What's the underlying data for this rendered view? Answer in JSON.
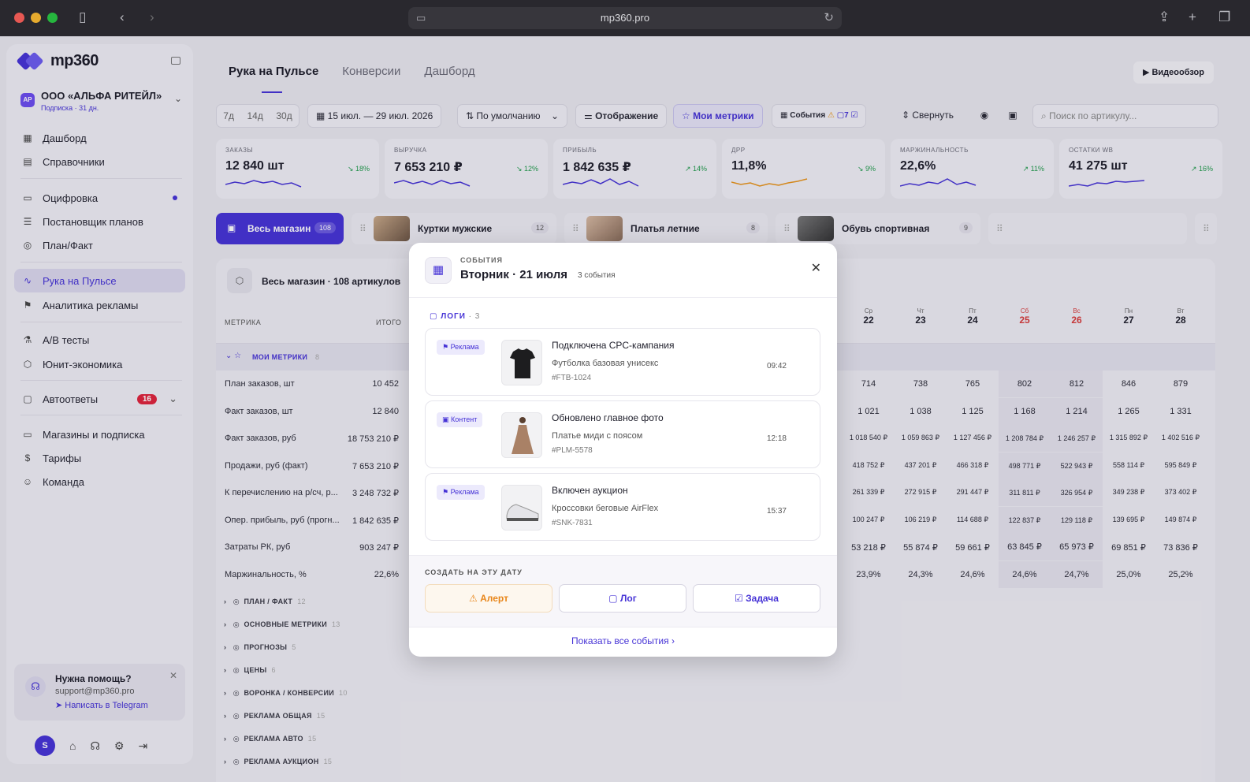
{
  "browser": {
    "url": "mp360.pro"
  },
  "sidebar": {
    "logo": "mp360",
    "org": {
      "avatar": "AP",
      "name": "ООО «АЛЬФА РИТЕЙЛ»",
      "sub": "Подписка · 31 дн."
    },
    "items": [
      {
        "label": "Дашборд",
        "icon": "▦"
      },
      {
        "label": "Справочники",
        "icon": "▤"
      },
      {
        "label": "Оцифровка",
        "icon": "▭"
      },
      {
        "label": "Постановщик планов",
        "icon": "☰"
      },
      {
        "label": "План/Факт",
        "icon": "◎"
      },
      {
        "label": "Рука на Пульсе",
        "icon": "∿"
      },
      {
        "label": "Аналитика рекламы",
        "icon": "⚑"
      },
      {
        "label": "A/B тесты",
        "icon": "⚗"
      },
      {
        "label": "Юнит-экономика",
        "icon": "⬡"
      },
      {
        "label": "Автоответы",
        "icon": "▢",
        "badge": "16"
      },
      {
        "label": "Магазины и подписка",
        "icon": "▭"
      },
      {
        "label": "Тарифы",
        "icon": "$"
      },
      {
        "label": "Команда",
        "icon": "☺"
      }
    ],
    "help": {
      "title": "Нужна помощь?",
      "email": "support@mp360.pro",
      "link": "Написать в Telegram"
    },
    "user": "S"
  },
  "main": {
    "tabs": [
      "Рука на Пульсе",
      "Конверсии",
      "Дашборд"
    ],
    "video": "Видеообзор",
    "toolbar": {
      "d7": "7д",
      "d14": "14д",
      "d30": "30д",
      "range": "15 июл. — 29 июл. 2026",
      "sort": "По умолчанию",
      "display": "Отображение",
      "my": "Мои метрики",
      "events": "События",
      "evcount": "7",
      "collapse": "Свернуть",
      "search_placeholder": "Поиск по артикулу..."
    },
    "kpis": [
      {
        "label": "ЗАКАЗЫ",
        "value": "12 840 шт",
        "change": "↘ 18%",
        "color": "#4633d6"
      },
      {
        "label": "ВЫРУЧКА",
        "value": "7 653 210 ₽",
        "change": "↘ 12%",
        "color": "#4633d6"
      },
      {
        "label": "ПРИБЫЛЬ",
        "value": "1 842 635 ₽",
        "change": "↗ 14%",
        "color": "#4633d6"
      },
      {
        "label": "ДРР",
        "value": "11,8%",
        "change": "↘ 9%",
        "color": "#e8941a"
      },
      {
        "label": "МАРЖИНАЛЬНОСТЬ",
        "value": "22,6%",
        "change": "↗ 11%",
        "color": "#4633d6"
      },
      {
        "label": "ОСТАТКИ WB",
        "value": "41 275 шт",
        "change": "↗ 16%",
        "color": "#4633d6"
      }
    ],
    "segments": [
      {
        "name": "Весь магазин",
        "count": "108"
      },
      {
        "name": "Куртки мужские",
        "count": "12"
      },
      {
        "name": "Платья летние",
        "count": "8"
      },
      {
        "name": "Обувь спортивная",
        "count": "9"
      }
    ],
    "table": {
      "title": "Весь магазин · 108 артикулов",
      "col_metric": "МЕТРИКА",
      "col_total": "ИТОГО",
      "days": [
        {
          "w": "Ср",
          "d": "22"
        },
        {
          "w": "Чт",
          "d": "23"
        },
        {
          "w": "Пт",
          "d": "24"
        },
        {
          "w": "Сб",
          "d": "25"
        },
        {
          "w": "Вс",
          "d": "26"
        },
        {
          "w": "Пн",
          "d": "27"
        },
        {
          "w": "Вт",
          "d": "28"
        }
      ],
      "my_metrics": "МОИ МЕТРИКИ",
      "my_count": "8",
      "rows": [
        {
          "m": "План заказов, шт",
          "t": "10 452",
          "v": [
            "714",
            "738",
            "765",
            "802",
            "812",
            "846",
            "879"
          ]
        },
        {
          "m": "Факт заказов, шт",
          "t": "12 840",
          "v": [
            "1 021",
            "1 038",
            "1 125",
            "1 168",
            "1 214",
            "1 265",
            "1 331"
          ]
        },
        {
          "m": "Факт заказов, руб",
          "t": "18 753 210 ₽",
          "v": [
            "1 018 540 ₽",
            "1 059 863 ₽",
            "1 127 456 ₽",
            "1 208 784 ₽",
            "1 246 257 ₽",
            "1 315 892 ₽",
            "1 402 516 ₽"
          ]
        },
        {
          "m": "Продажи, руб (факт)",
          "t": "7 653 210 ₽",
          "v": [
            "418 752 ₽",
            "437 201 ₽",
            "466 318 ₽",
            "498 771 ₽",
            "522 943 ₽",
            "558 114 ₽",
            "595 849 ₽"
          ]
        },
        {
          "m": "К перечислению на р/сч, р...",
          "t": "3 248 732 ₽",
          "v": [
            "261 339 ₽",
            "272 915 ₽",
            "291 447 ₽",
            "311 811 ₽",
            "326 954 ₽",
            "349 238 ₽",
            "373 402 ₽"
          ]
        },
        {
          "m": "Опер. прибыль, руб (прогн...",
          "t": "1 842 635 ₽",
          "v": [
            "100 247 ₽",
            "106 219 ₽",
            "114 688 ₽",
            "122 837 ₽",
            "129 118 ₽",
            "139 695 ₽",
            "149 874 ₽"
          ]
        },
        {
          "m": "Затраты РК, руб",
          "t": "903 247 ₽",
          "v": [
            "53 218 ₽",
            "55 874 ₽",
            "59 661 ₽",
            "63 845 ₽",
            "65 973 ₽",
            "69 851 ₽",
            "73 836 ₽"
          ]
        },
        {
          "m": "Маржинальность, %",
          "t": "22,6%",
          "v": [
            "23,9%",
            "24,3%",
            "24,6%",
            "24,6%",
            "24,7%",
            "25,0%",
            "25,2%"
          ]
        }
      ],
      "groups": [
        {
          "n": "ПЛАН / ФАКТ",
          "c": "12"
        },
        {
          "n": "ОСНОВНЫЕ МЕТРИКИ",
          "c": "13"
        },
        {
          "n": "ПРОГНОЗЫ",
          "c": "5"
        },
        {
          "n": "ЦЕНЫ",
          "c": "6"
        },
        {
          "n": "ВОРОНКА / КОНВЕРСИИ",
          "c": "10"
        },
        {
          "n": "РЕКЛАМА ОБЩАЯ",
          "c": "15"
        },
        {
          "n": "РЕКЛАМА АВТО",
          "c": "15"
        },
        {
          "n": "РЕКЛАМА АУКЦИОН",
          "c": "15"
        }
      ]
    }
  },
  "modal": {
    "sup": "СОБЫТИЯ",
    "title": "Вторник · 21 июля",
    "count": "3 события",
    "logs": "ЛОГИ",
    "logs_count": "· 3",
    "events": [
      {
        "tag": "Реклама",
        "title": "Подключена CPC-кампания",
        "product": "Футболка базовая унисекс",
        "sku": "#FTB-1024",
        "time": "09:42"
      },
      {
        "tag": "Контент",
        "title": "Обновлено главное фото",
        "product": "Платье миди с поясом",
        "sku": "#PLM-5578",
        "time": "12:18"
      },
      {
        "tag": "Реклама",
        "title": "Включен аукцион",
        "product": "Кроссовки беговые AirFlex",
        "sku": "#SNK-7831",
        "time": "15:37"
      }
    ],
    "create": "СОЗДАТЬ НА ЭТУ ДАТУ",
    "btn_alert": "Алерт",
    "btn_log": "Лог",
    "btn_task": "Задача",
    "show_all": "Показать все события"
  }
}
